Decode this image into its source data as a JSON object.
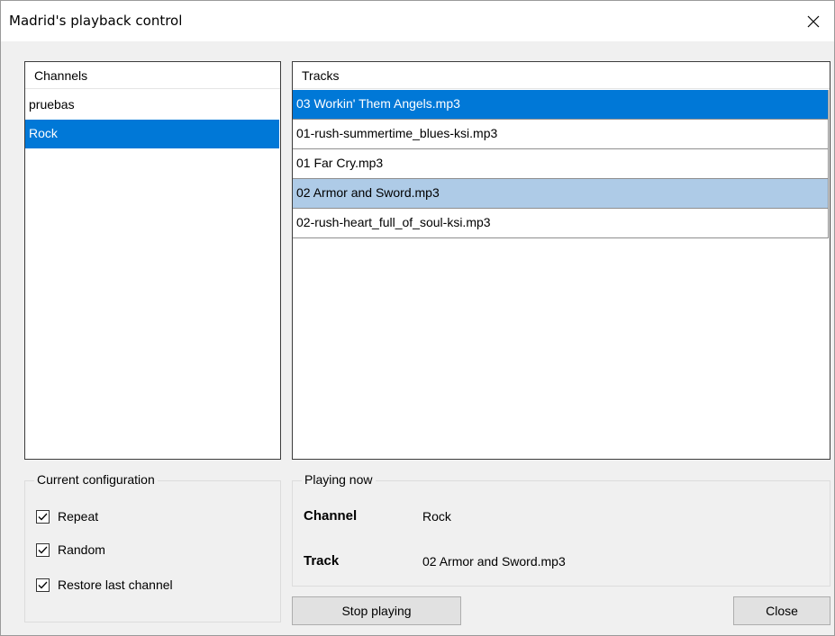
{
  "window": {
    "title": "Madrid's playback control",
    "close_icon": "close-icon"
  },
  "channels": {
    "header": "Channels",
    "items": [
      {
        "label": "pruebas",
        "selected": false
      },
      {
        "label": "Rock",
        "selected": true
      }
    ]
  },
  "tracks": {
    "header": "Tracks",
    "items": [
      {
        "label": "03 Workin' Them Angels.mp3",
        "state": "selected"
      },
      {
        "label": "01-rush-summertime_blues-ksi.mp3",
        "state": "normal"
      },
      {
        "label": "01 Far Cry.mp3",
        "state": "normal"
      },
      {
        "label": "02 Armor and Sword.mp3",
        "state": "highlight"
      },
      {
        "label": "02-rush-heart_full_of_soul-ksi.mp3",
        "state": "normal"
      }
    ]
  },
  "configuration": {
    "title": "Current configuration",
    "options": [
      {
        "label": "Repeat",
        "checked": true
      },
      {
        "label": "Random",
        "checked": true
      },
      {
        "label": "Restore last channel",
        "checked": true
      }
    ]
  },
  "playing_now": {
    "title": "Playing now",
    "channel_label": "Channel",
    "channel_value": "Rock",
    "track_label": "Track",
    "track_value": "02 Armor and Sword.mp3"
  },
  "buttons": {
    "stop_label": "Stop playing",
    "close_label": "Close"
  },
  "colors": {
    "selection": "#0078d7",
    "secondary_selection": "#aecbe7",
    "window_bg": "#f0f0f0"
  }
}
